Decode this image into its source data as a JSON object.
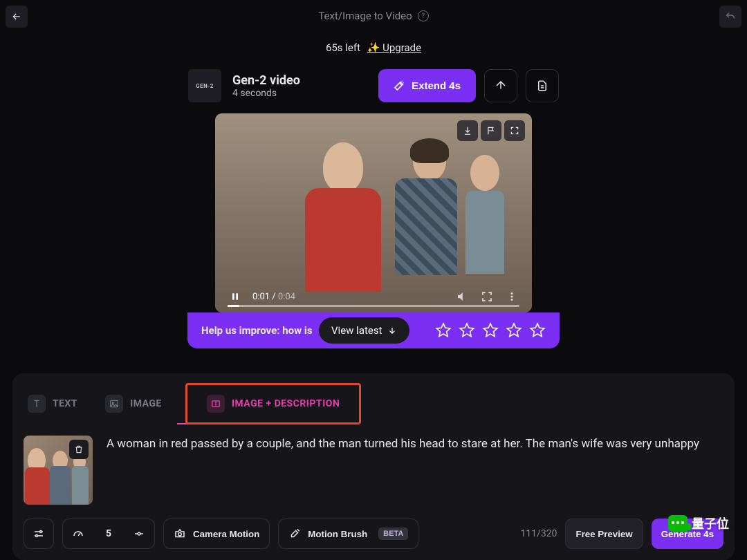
{
  "header": {
    "title": "Text/Image to Video",
    "time_left": "65s left",
    "upgrade_label": "✨ Upgrade"
  },
  "video_info": {
    "model_badge": "GEN-2",
    "title": "Gen-2 video",
    "duration_label": "4 seconds",
    "extend_label": "Extend 4s"
  },
  "player": {
    "current_time": "0:01",
    "duration": "0:04"
  },
  "feedback": {
    "prompt": "Help us improve: how is",
    "view_latest": "View latest"
  },
  "tabs": {
    "text": "TEXT",
    "image": "IMAGE",
    "image_desc": "IMAGE + DESCRIPTION"
  },
  "prompt": {
    "text": "A woman in red passed by a couple, and the man turned his head to stare at her. The man's wife was very unhappy"
  },
  "controls": {
    "num_value": "5",
    "camera_motion": "Camera Motion",
    "motion_brush": "Motion Brush",
    "beta": "BETA",
    "counter": "111/320",
    "free_preview": "Free Preview",
    "generate": "Generate 4s"
  },
  "watermark": "量子位"
}
